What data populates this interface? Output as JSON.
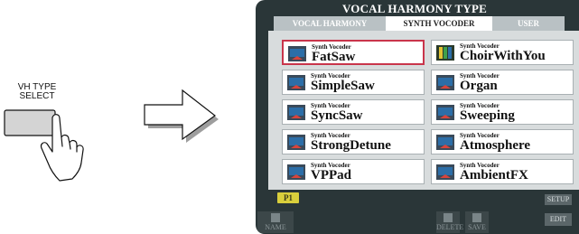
{
  "panel_button": {
    "label_line1": "VH TYPE",
    "label_line2": "SELECT"
  },
  "screen": {
    "title": "VOCAL HARMONY TYPE",
    "tabs": [
      {
        "label": "VOCAL HARMONY",
        "active": false
      },
      {
        "label": "SYNTH VOCODER",
        "active": true
      },
      {
        "label": "USER",
        "active": false
      }
    ],
    "voices": [
      {
        "category": "Synth Vocoder",
        "name": "FatSaw",
        "selected": true
      },
      {
        "category": "Synth Vocoder",
        "name": "ChoirWithYou",
        "selected": false
      },
      {
        "category": "Synth Vocoder",
        "name": "SimpleSaw",
        "selected": false
      },
      {
        "category": "Synth Vocoder",
        "name": "Organ",
        "selected": false
      },
      {
        "category": "Synth Vocoder",
        "name": "SyncSaw",
        "selected": false
      },
      {
        "category": "Synth Vocoder",
        "name": "Sweeping",
        "selected": false
      },
      {
        "category": "Synth Vocoder",
        "name": "StrongDetune",
        "selected": false
      },
      {
        "category": "Synth Vocoder",
        "name": "Atmosphere",
        "selected": false
      },
      {
        "category": "Synth Vocoder",
        "name": "VPPad",
        "selected": false
      },
      {
        "category": "Synth Vocoder",
        "name": "AmbientFX",
        "selected": false
      }
    ],
    "page_label": "P1",
    "setup_label": "SETUP",
    "edit_label": "EDIT",
    "name_label": "NAME",
    "delete_label": "DELETE",
    "save_label": "SAVE"
  },
  "colors": {
    "screen_bg": "#2a3638",
    "panel_bg": "#d8dcdd",
    "selected_border": "#c9354b",
    "page_badge": "#d9cf3c"
  }
}
